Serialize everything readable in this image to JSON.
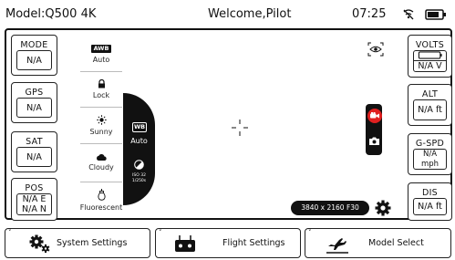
{
  "status_bar": {
    "model": "Model:Q500 4K",
    "welcome": "Welcome,Pilot",
    "time": "07:25",
    "signal_icon": "no-signal-icon",
    "battery_icon": "battery-icon"
  },
  "left_panel": {
    "mode": {
      "label": "MODE",
      "value": "N/A"
    },
    "gps": {
      "label": "GPS",
      "value": "N/A"
    },
    "sat": {
      "label": "SAT",
      "value": "N/A"
    },
    "pos": {
      "label": "POS",
      "value_e": "N/A E",
      "value_n": "N/A N"
    }
  },
  "right_panel": {
    "volts": {
      "label": "VOLTS",
      "value": "N/A V"
    },
    "alt": {
      "label": "ALT",
      "value": "N/A ft"
    },
    "gspd": {
      "label": "G-SPD",
      "value": "N/A mph"
    },
    "dis": {
      "label": "DIS",
      "value": "N/A ft"
    }
  },
  "white_balance": {
    "items": [
      {
        "badge": "AWB",
        "label": "Auto",
        "icon": "awb-icon"
      },
      {
        "label": "Lock",
        "icon": "lock-icon"
      },
      {
        "label": "Sunny",
        "icon": "sun-icon"
      },
      {
        "label": "Cloudy",
        "icon": "cloud-icon"
      },
      {
        "label": "Fluorescent",
        "icon": "fluorescent-bulb-icon"
      }
    ],
    "tab": {
      "badge": "WB",
      "label": "Auto",
      "iso": "ISO 32",
      "shutter": "1/250s"
    }
  },
  "camera": {
    "resolution": "3840 x 2160 F30",
    "record_color": "#e02020"
  },
  "nav": {
    "system_settings": "System Settings",
    "flight_settings": "Flight Settings",
    "model_select": "Model Select",
    "caret": "˅"
  }
}
